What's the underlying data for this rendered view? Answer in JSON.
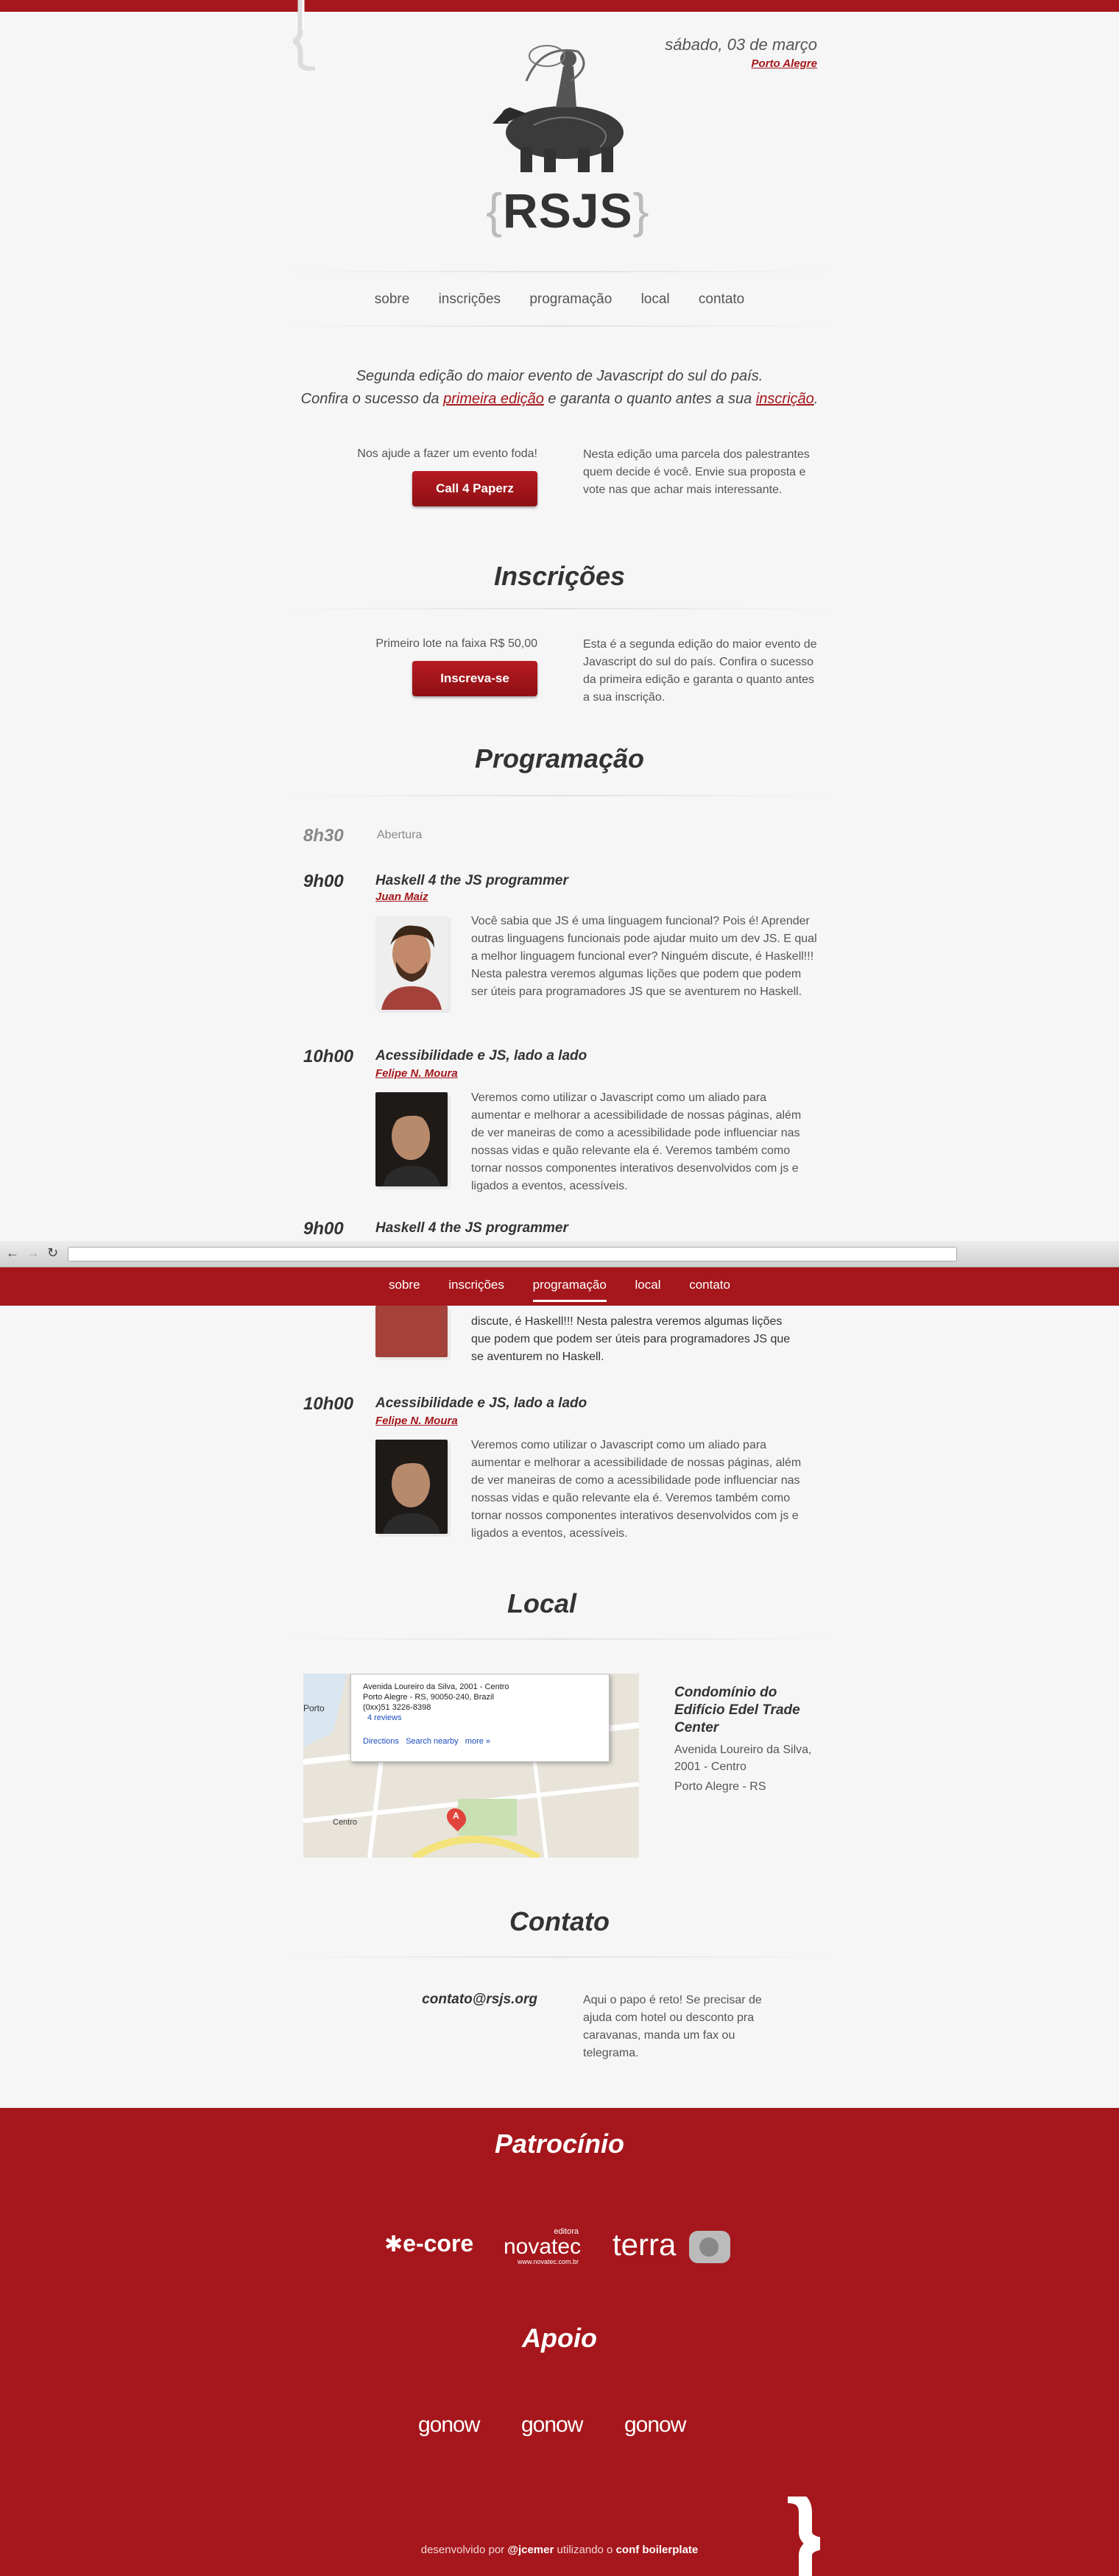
{
  "header": {
    "date": "sábado, 03 de março",
    "city": "Porto Alegre",
    "logo_open": "{",
    "logo_text": "RSJS",
    "logo_close": "}"
  },
  "nav": {
    "items": [
      "sobre",
      "inscrições",
      "programação",
      "local",
      "contato"
    ]
  },
  "intro": {
    "line1": "Segunda edição do maior evento de Javascript do sul do país.",
    "line2_a": "Confira o sucesso da ",
    "line2_link1": "primeira edição",
    "line2_b": " e garanta o quanto antes a sua ",
    "line2_link2": "inscrição",
    "line2_c": "."
  },
  "papers": {
    "left_text": "Nos ajude a fazer um evento foda!",
    "button": "Call 4 Paperz",
    "right_text": "Nesta edição uma parcela dos palestrantes quem decide é você. Envie sua proposta e vote nas que achar mais interessante."
  },
  "inscricoes": {
    "title": "Inscrições",
    "left_text": "Primeiro lote na faixa R$ 50,00",
    "button": "Inscreva-se",
    "right_text": "Esta é a segunda edição do maior evento de Javascript do sul do país. Confira o sucesso da primeira edição e garanta o quanto antes a sua inscrição."
  },
  "programacao": {
    "title": "Programação",
    "opening_time": "8h30",
    "opening_label": "Abertura",
    "talks": [
      {
        "time": "9h00",
        "title": "Haskell 4 the JS programmer",
        "speaker": "Juan Maiz",
        "desc": "Você sabia que JS é uma linguagem funcional? Pois é! Aprender outras linguagens funcionais pode ajudar muito um dev JS. E qual a melhor linguagem funcional ever? Ninguém discute, é Haskell!!! Nesta palestra veremos algumas lições que podem que podem ser úteis para programadores JS que se aventurem no Haskell."
      },
      {
        "time": "10h00",
        "title": "Acessibilidade e JS, lado a lado",
        "speaker": "Felipe N. Moura",
        "desc": "Veremos como utilizar o Javascript como um aliado para aumentar e melhorar a acessibilidade de nossas páginas, além de ver maneiras de como a acessibilidade pode influenciar nas nossas vidas e quão relevante ela é. Veremos também como tornar nossos componentes interativos desenvolvidos com js e ligados a eventos, acessíveis."
      }
    ],
    "partial_time": "9h00",
    "partial_title": "Haskell 4 the JS programmer",
    "scrolled_desc_a": "discute, é Haskell!!! Nesta palestra veremos algumas lições",
    "scrolled_desc_b": "que podem que podem ser úteis para programadores JS que",
    "scrolled_desc_c": "se aventurem no Haskell."
  },
  "sticky_nav": {
    "items": [
      "sobre",
      "inscrições",
      "programação",
      "local",
      "contato"
    ],
    "active": "programação"
  },
  "local": {
    "title": "Local",
    "venue": "Condomínio do Edifício Edel Trade Center",
    "address1": "Avenida Loureiro da Silva, 2001 - Centro",
    "address2": "Porto Alegre - RS",
    "map_popup_line1": "Avenida Loureiro da Silva, 2001 - Centro",
    "map_popup_line2": "Porto Alegre - RS, 90050-240, Brazil",
    "map_popup_line3": "(0xx)51 3226-8398",
    "map_popup_reviews": "4 reviews",
    "map_link_directions": "Directions",
    "map_link_search": "Search nearby",
    "map_link_more": "more »",
    "map_marker": "A",
    "map_label_porto": "Porto",
    "map_label_centro": "Centro"
  },
  "contato": {
    "title": "Contato",
    "email": "contato@rsjs.org",
    "text": "Aqui o papo é reto! Se precisar de ajuda com hotel ou desconto pra caravanas, manda um fax ou telegrama."
  },
  "patrocinio": {
    "title": "Patrocínio",
    "sponsors": [
      "e-core",
      "novatec",
      "terra"
    ],
    "novatec_tag": "editora",
    "novatec_url": "www.novatec.com.br"
  },
  "apoio": {
    "title": "Apoio",
    "supporters": [
      "gonow",
      "gonow",
      "gonow"
    ]
  },
  "footer": {
    "text_a": "desenvolvido por ",
    "author": "@jcemer",
    "text_b": " utilizando o ",
    "project": "conf boilerplate"
  },
  "colors": {
    "brand_red": "#a5171c",
    "background": "#f6f6f6"
  }
}
